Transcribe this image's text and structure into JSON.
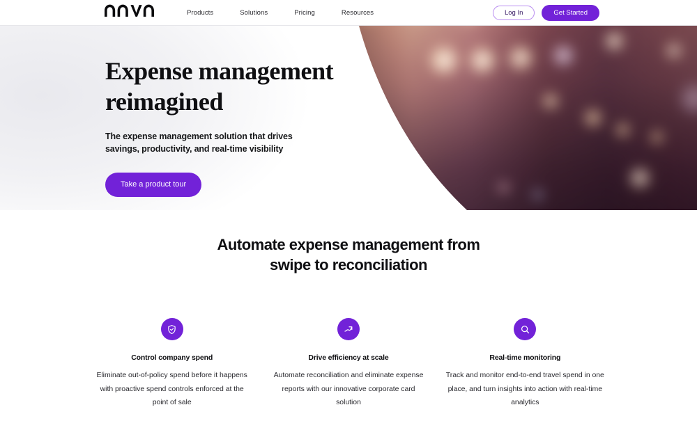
{
  "brand": {
    "logo_text": "navan",
    "accent_color": "#7222d8",
    "accent_dark": "#5f16bb"
  },
  "navbar": {
    "links": [
      {
        "label": "Products",
        "icon": "products-nav-item"
      },
      {
        "label": "Solutions",
        "icon": "solutions-nav-item"
      },
      {
        "label": "Pricing",
        "icon": "pricing-nav-item"
      },
      {
        "label": "Resources",
        "icon": "resources-nav-item"
      }
    ],
    "login_label": "Log In",
    "get_started_label": "Get Started"
  },
  "hero": {
    "title_line1": "Expense management",
    "title_line2": "reimagined",
    "subtitle": "The expense management solution that drives savings, productivity, and real-time visibility",
    "cta_label": "Take a product tour",
    "image_alt": "blurred-night-city-bokeh-lights"
  },
  "features": {
    "section_title_line1": "Automate expense management from",
    "section_title_line2": "swipe to reconciliation",
    "cards": [
      {
        "icon": "shield-check-icon",
        "title": "Control company spend",
        "body": "Eliminate out-of-policy spend before it happens with proactive spend controls enforced at the point of sale"
      },
      {
        "icon": "trending-up-arrow-icon",
        "title": "Drive efficiency at scale",
        "body": "Automate reconciliation and eliminate expense reports with our innovative corporate card solution"
      },
      {
        "icon": "search-icon",
        "title": "Real-time monitoring",
        "body": "Track and monitor end-to-end travel spend in one place, and turn insights into action with real-time analytics"
      }
    ]
  }
}
